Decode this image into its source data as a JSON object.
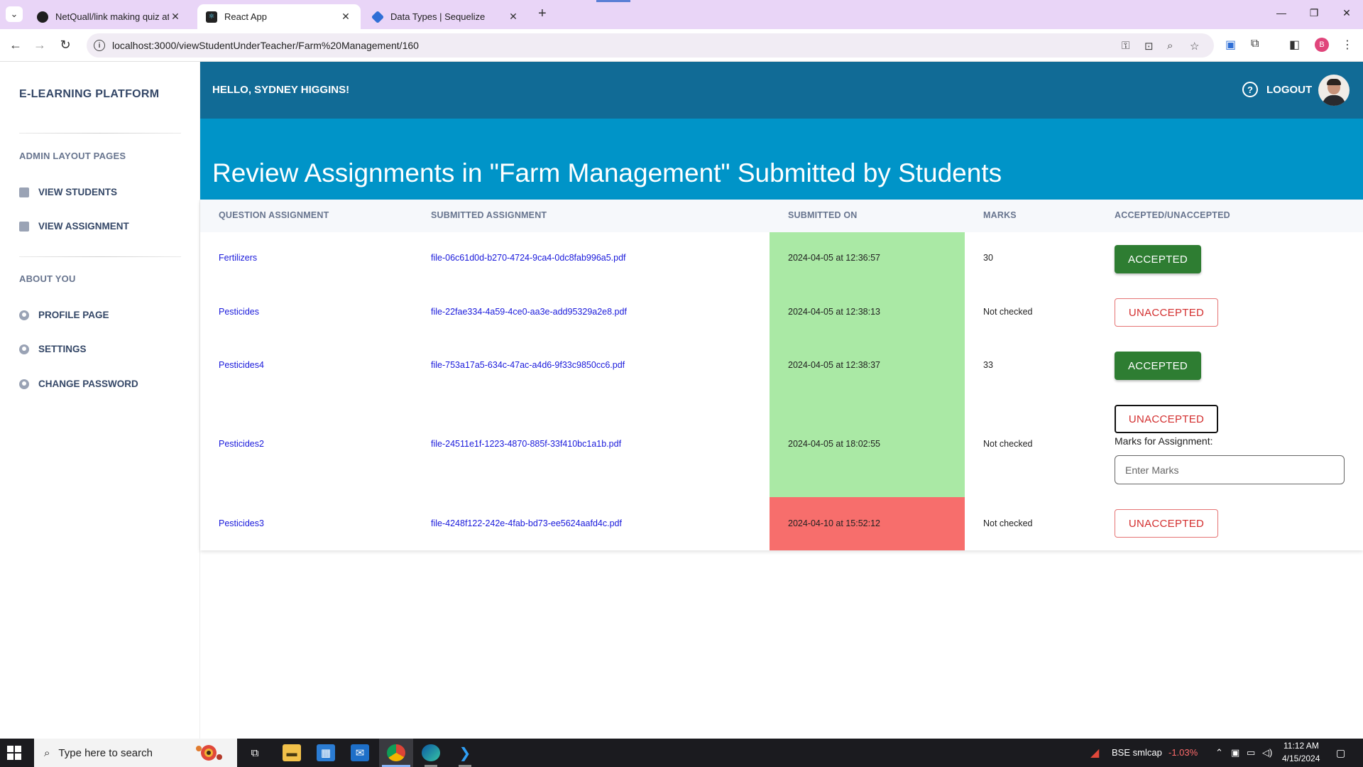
{
  "browser": {
    "tabs": [
      {
        "title": "NetQuall/link making quiz at m",
        "active": false
      },
      {
        "title": "React App",
        "active": true
      },
      {
        "title": "Data Types | Sequelize",
        "active": false
      }
    ],
    "url": "localhost:3000/viewStudentUnderTeacher/Farm%20Management/160",
    "profile_initial": "B"
  },
  "sidebar": {
    "brand": "E-LEARNING PLATFORM",
    "section1": "ADMIN LAYOUT PAGES",
    "items1": [
      {
        "label": "VIEW STUDENTS",
        "icon": "document-icon"
      },
      {
        "label": "VIEW ASSIGNMENT",
        "icon": "document-icon"
      }
    ],
    "section2": "ABOUT YOU",
    "items2": [
      {
        "label": "PROFILE PAGE",
        "icon": "user-circle-icon"
      },
      {
        "label": "SETTINGS",
        "icon": "user-circle-icon"
      },
      {
        "label": "CHANGE PASSWORD",
        "icon": "user-circle-icon"
      }
    ]
  },
  "header": {
    "greeting": "HELLO, SYDNEY HIGGINS!",
    "help_glyph": "?",
    "logout": "LOGOUT"
  },
  "page": {
    "title": "Review Assignments in \"Farm Management\" Submitted by Students"
  },
  "table": {
    "columns": [
      "QUESTION ASSIGNMENT",
      "SUBMITTED ASSIGNMENT",
      "SUBMITTED ON",
      "MARKS",
      "ACCEPTED/UNACCEPTED"
    ],
    "rows": [
      {
        "question": "Fertilizers",
        "file": "file-06c61d0d-b270-4724-9ca4-0dc8fab996a5.pdf",
        "submitted_on": "2024-04-05 at 12:36:57",
        "on_time": true,
        "marks": "30",
        "status": "ACCEPTED"
      },
      {
        "question": "Pesticides",
        "file": "file-22fae334-4a59-4ce0-aa3e-add95329a2e8.pdf",
        "submitted_on": "2024-04-05 at 12:38:13",
        "on_time": true,
        "marks": "Not checked",
        "status": "UNACCEPTED"
      },
      {
        "question": "Pesticides4",
        "file": "file-753a17a5-634c-47ac-a4d6-9f33c9850cc6.pdf",
        "submitted_on": "2024-04-05 at 12:38:37",
        "on_time": true,
        "marks": "33",
        "status": "ACCEPTED"
      },
      {
        "question": "Pesticides2",
        "file": "file-24511e1f-1223-4870-885f-33f410bc1a1b.pdf",
        "submitted_on": "2024-04-05 at 18:02:55",
        "on_time": true,
        "marks": "Not checked",
        "status": "UNACCEPTED"
      },
      {
        "question": "Pesticides3",
        "file": "file-4248f122-242e-4fab-bd73-ee5624aafd4c.pdf",
        "submitted_on": "2024-04-10 at 15:52:12",
        "on_time": false,
        "marks": "Not checked",
        "status": "UNACCEPTED"
      }
    ],
    "marks_form": {
      "label": "Marks for Assignment:",
      "placeholder": "Enter Marks"
    }
  },
  "colors": {
    "topbar": "#116b96",
    "banner": "#0094c8",
    "on_time": "#aae9a5",
    "late": "#f76e6c",
    "accepted": "#2e7d32",
    "unaccepted": "#d32f2f"
  },
  "taskbar": {
    "search_placeholder": "Type here to search",
    "stock_name": "BSE smlcap",
    "stock_change": "-1.03%",
    "time": "11:12 AM",
    "date": "4/15/2024"
  }
}
